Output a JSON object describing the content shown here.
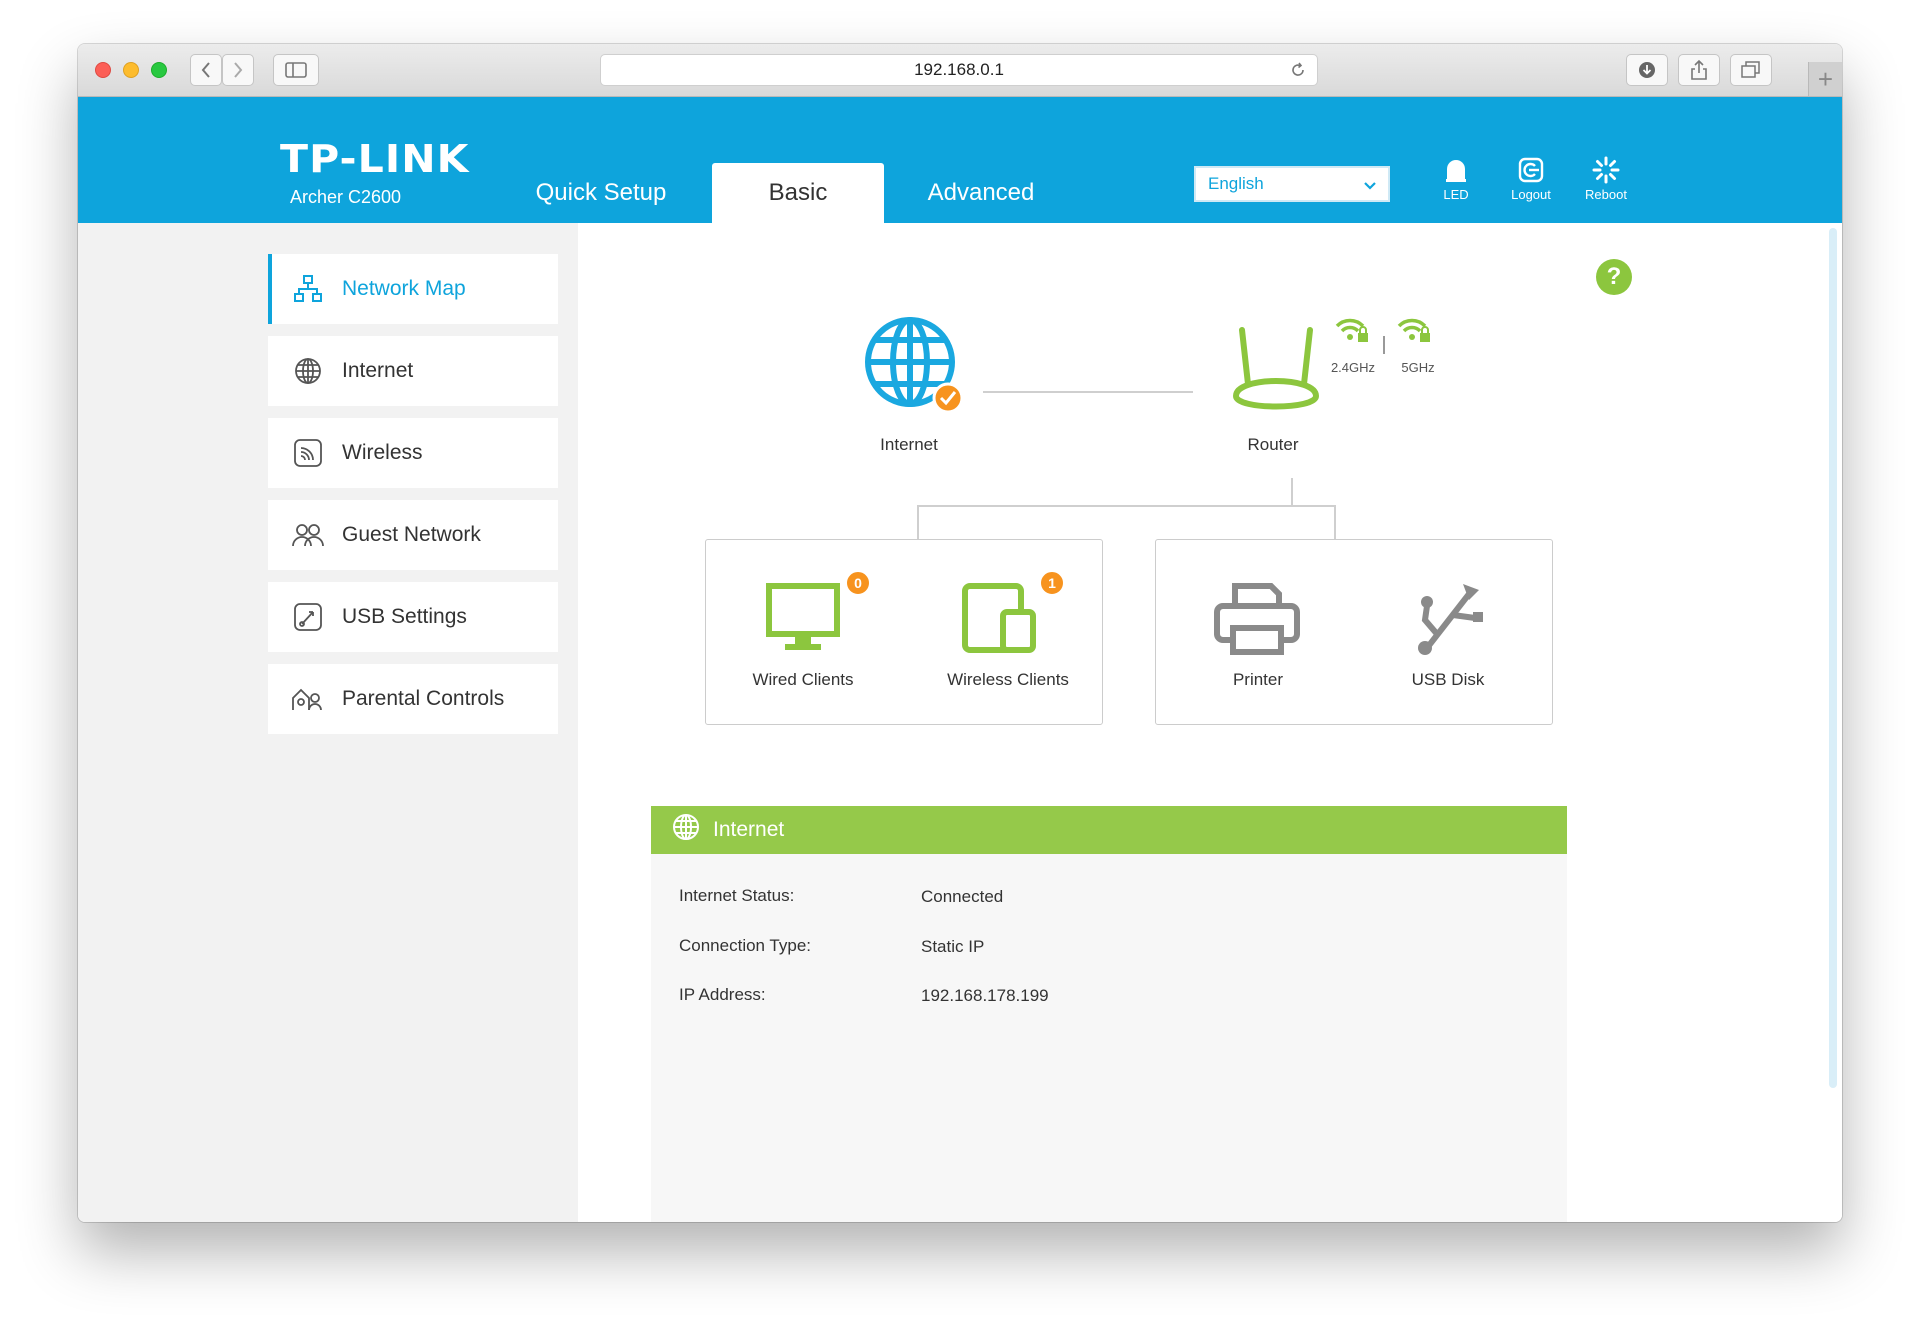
{
  "browser": {
    "url": "192.168.0.1"
  },
  "brand": {
    "logo": "TP-LINK",
    "model": "Archer C2600"
  },
  "tabs": [
    {
      "label": "Quick Setup"
    },
    {
      "label": "Basic"
    },
    {
      "label": "Advanced"
    }
  ],
  "language": {
    "selected": "English"
  },
  "header_actions": {
    "led": "LED",
    "logout": "Logout",
    "reboot": "Reboot"
  },
  "sidebar": {
    "items": [
      {
        "label": "Network Map",
        "icon": "network-map-icon"
      },
      {
        "label": "Internet",
        "icon": "globe-icon"
      },
      {
        "label": "Wireless",
        "icon": "wireless-icon"
      },
      {
        "label": "Guest Network",
        "icon": "guest-icon"
      },
      {
        "label": "USB Settings",
        "icon": "usb-settings-icon"
      },
      {
        "label": "Parental Controls",
        "icon": "parental-icon"
      }
    ]
  },
  "map": {
    "internet_label": "Internet",
    "router_label": "Router",
    "band_24": "2.4GHz",
    "band_5": "5GHz",
    "wired_label": "Wired Clients",
    "wired_count": "0",
    "wireless_label": "Wireless Clients",
    "wireless_count": "1",
    "printer_label": "Printer",
    "usb_label": "USB Disk"
  },
  "info": {
    "title": "Internet",
    "rows": [
      {
        "label": "Internet Status:",
        "value": "Connected"
      },
      {
        "label": "Connection Type:",
        "value": "Static IP"
      },
      {
        "label": "IP Address:",
        "value": "192.168.178.199"
      }
    ]
  },
  "colors": {
    "brand_blue": "#0ea4dc",
    "status_green": "#8cc63e",
    "badge_orange": "#f7931e"
  }
}
